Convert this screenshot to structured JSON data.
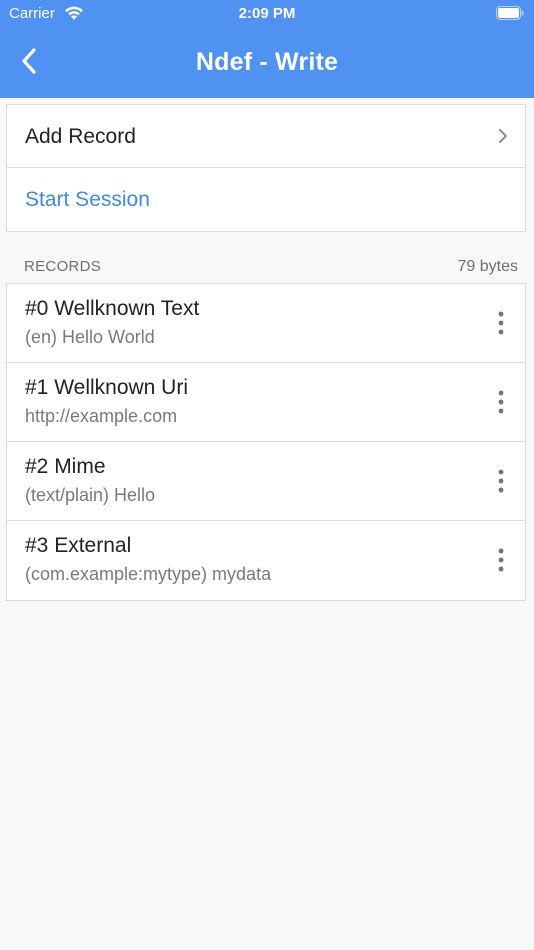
{
  "status_bar": {
    "carrier": "Carrier",
    "time": "2:09 PM",
    "wifi_icon": "wifi-icon",
    "battery_icon": "battery-icon"
  },
  "nav": {
    "title": "Ndef - Write",
    "back_icon": "chevron-left-icon"
  },
  "actions": {
    "add_record": "Add Record",
    "start_session": "Start Session"
  },
  "records_section": {
    "header": "RECORDS",
    "size": "79 bytes"
  },
  "records": [
    {
      "title": "#0 Wellknown Text",
      "subtitle": "(en) Hello World"
    },
    {
      "title": "#1 Wellknown Uri",
      "subtitle": "http://example.com"
    },
    {
      "title": "#2 Mime",
      "subtitle": "(text/plain) Hello"
    },
    {
      "title": "#3 External",
      "subtitle": "(com.example:mytype) mydata"
    }
  ],
  "colors": {
    "accent": "#5092f2",
    "link": "#3f8ae8",
    "background": "#f8f8f8"
  }
}
